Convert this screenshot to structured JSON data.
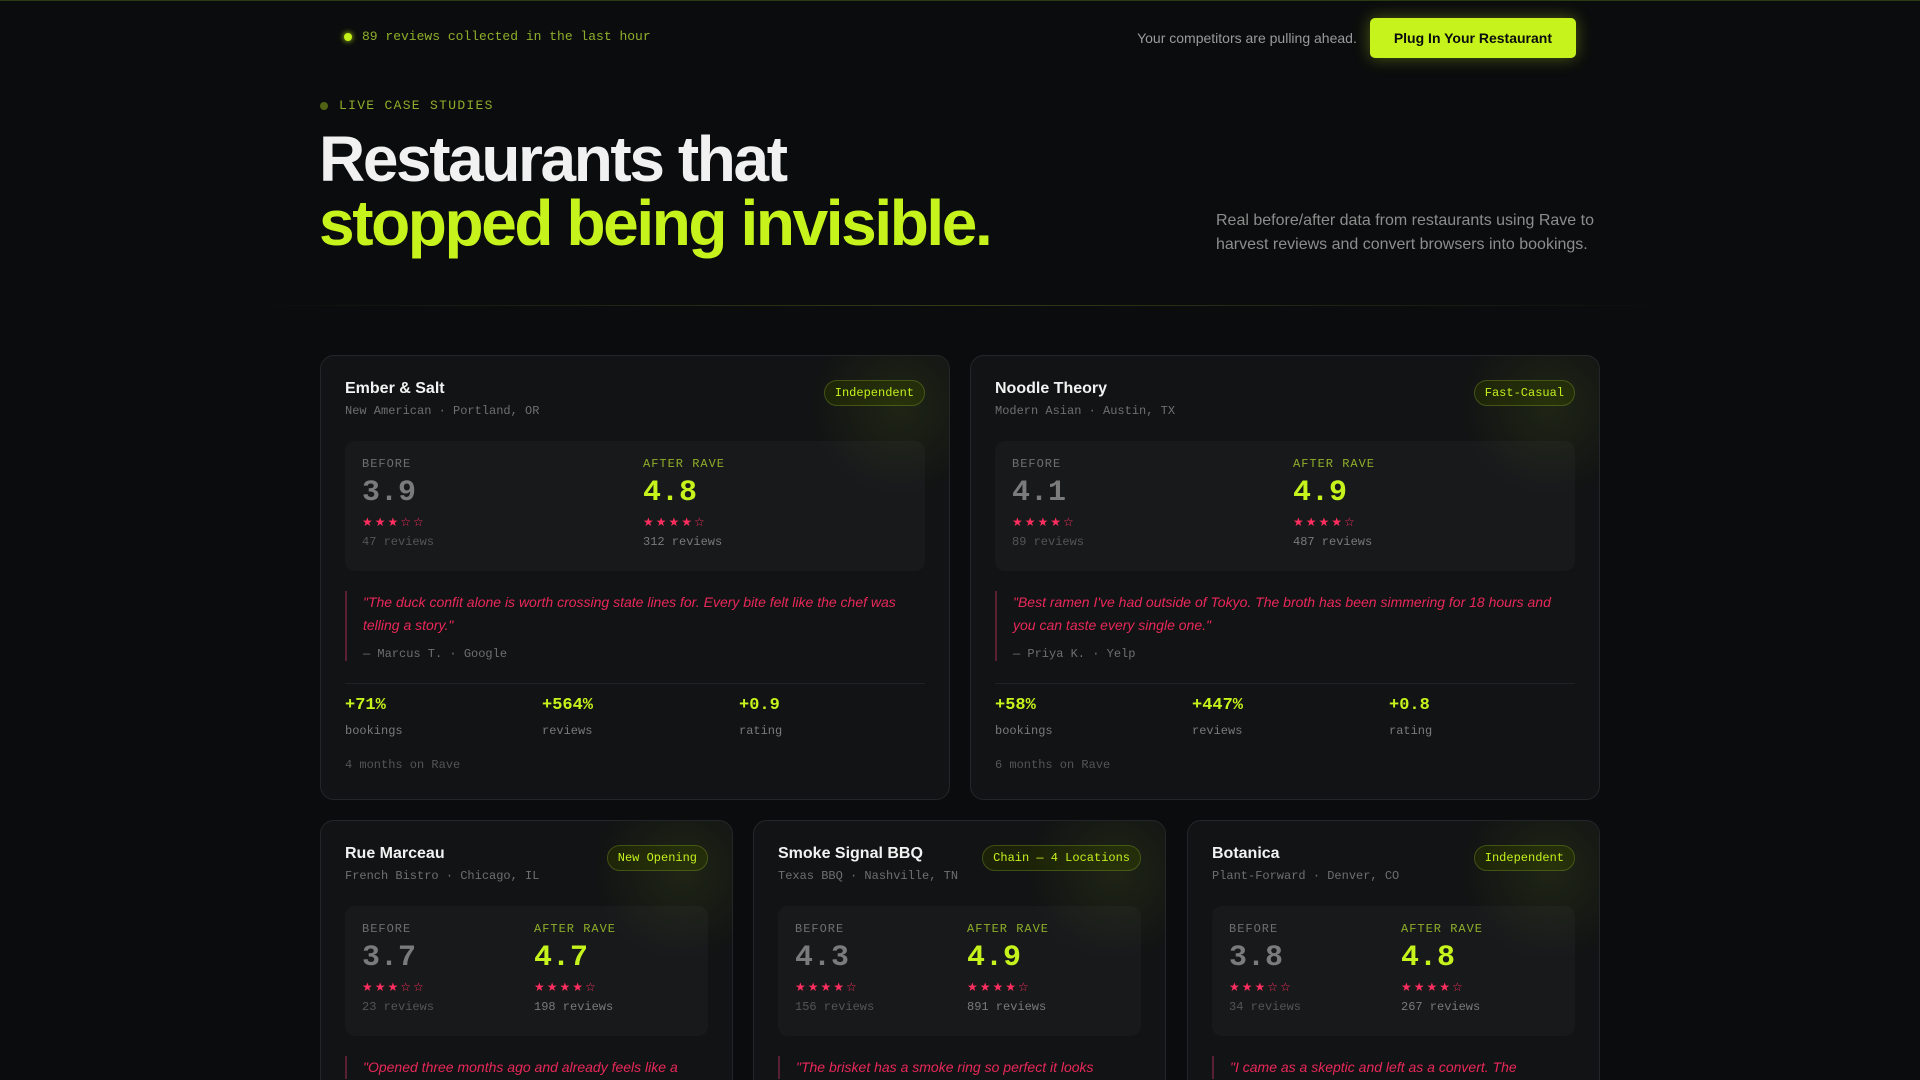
{
  "topbar": {
    "live_text": "89 reviews collected in the last hour",
    "tagline": "Your competitors are pulling ahead.",
    "cta_label": "Plug In Your Restaurant"
  },
  "hero": {
    "eyebrow": "LIVE CASE STUDIES",
    "title_line1": "Restaurants that",
    "title_line2": "stopped being invisible.",
    "lede": "Real before/after data from restaurants using Rave to harvest reviews and convert browsers into bookings."
  },
  "labels": {
    "before": "BEFORE",
    "after": "AFTER RAVE",
    "bookings": "bookings",
    "reviews": "reviews",
    "rating": "rating"
  },
  "colors": {
    "accent": "#c6f31c",
    "star": "#ff2e5f",
    "quote": "#e9285a",
    "background": "#0b0c0d"
  },
  "cards": [
    {
      "name": "Ember & Salt",
      "sub": "New American · Portland, OR",
      "badge": "Independent",
      "before_rating": "3.9",
      "before_stars": "★★★☆☆",
      "before_reviews": "47 reviews",
      "after_rating": "4.8",
      "after_stars": "★★★★☆",
      "after_reviews": "312 reviews",
      "quote": "\"The duck confit alone is worth crossing state lines for. Every bite felt like the chef was telling a story.\"",
      "quote_by": "— Marcus T. · Google",
      "stat_bookings": "+71%",
      "stat_reviews": "+564%",
      "stat_rating": "+0.9",
      "tenure": "4 months on Rave"
    },
    {
      "name": "Noodle Theory",
      "sub": "Modern Asian · Austin, TX",
      "badge": "Fast-Casual",
      "before_rating": "4.1",
      "before_stars": "★★★★☆",
      "before_reviews": "89 reviews",
      "after_rating": "4.9",
      "after_stars": "★★★★☆",
      "after_reviews": "487 reviews",
      "quote": "\"Best ramen I've had outside of Tokyo. The broth has been simmering for 18 hours and you can taste every single one.\"",
      "quote_by": "— Priya K. · Yelp",
      "stat_bookings": "+58%",
      "stat_reviews": "+447%",
      "stat_rating": "+0.8",
      "tenure": "6 months on Rave"
    },
    {
      "name": "Rue Marceau",
      "sub": "French Bistro · Chicago, IL",
      "badge": "New Opening",
      "before_rating": "3.7",
      "before_stars": "★★★☆☆",
      "before_reviews": "23 reviews",
      "after_rating": "4.7",
      "after_stars": "★★★★☆",
      "after_reviews": "198 reviews",
      "quote": "\"Opened three months ago and already feels like a"
    },
    {
      "name": "Smoke Signal BBQ",
      "sub": "Texas BBQ · Nashville, TN",
      "badge": "Chain — 4 Locations",
      "before_rating": "4.3",
      "before_stars": "★★★★☆",
      "before_reviews": "156 reviews",
      "after_rating": "4.9",
      "after_stars": "★★★★☆",
      "after_reviews": "891 reviews",
      "quote": "\"The brisket has a smoke ring so perfect it looks"
    },
    {
      "name": "Botanica",
      "sub": "Plant-Forward · Denver, CO",
      "badge": "Independent",
      "before_rating": "3.8",
      "before_stars": "★★★☆☆",
      "before_reviews": "34 reviews",
      "after_rating": "4.8",
      "after_stars": "★★★★☆",
      "after_reviews": "267 reviews",
      "quote": "\"I came as a skeptic and left as a convert. The"
    }
  ]
}
